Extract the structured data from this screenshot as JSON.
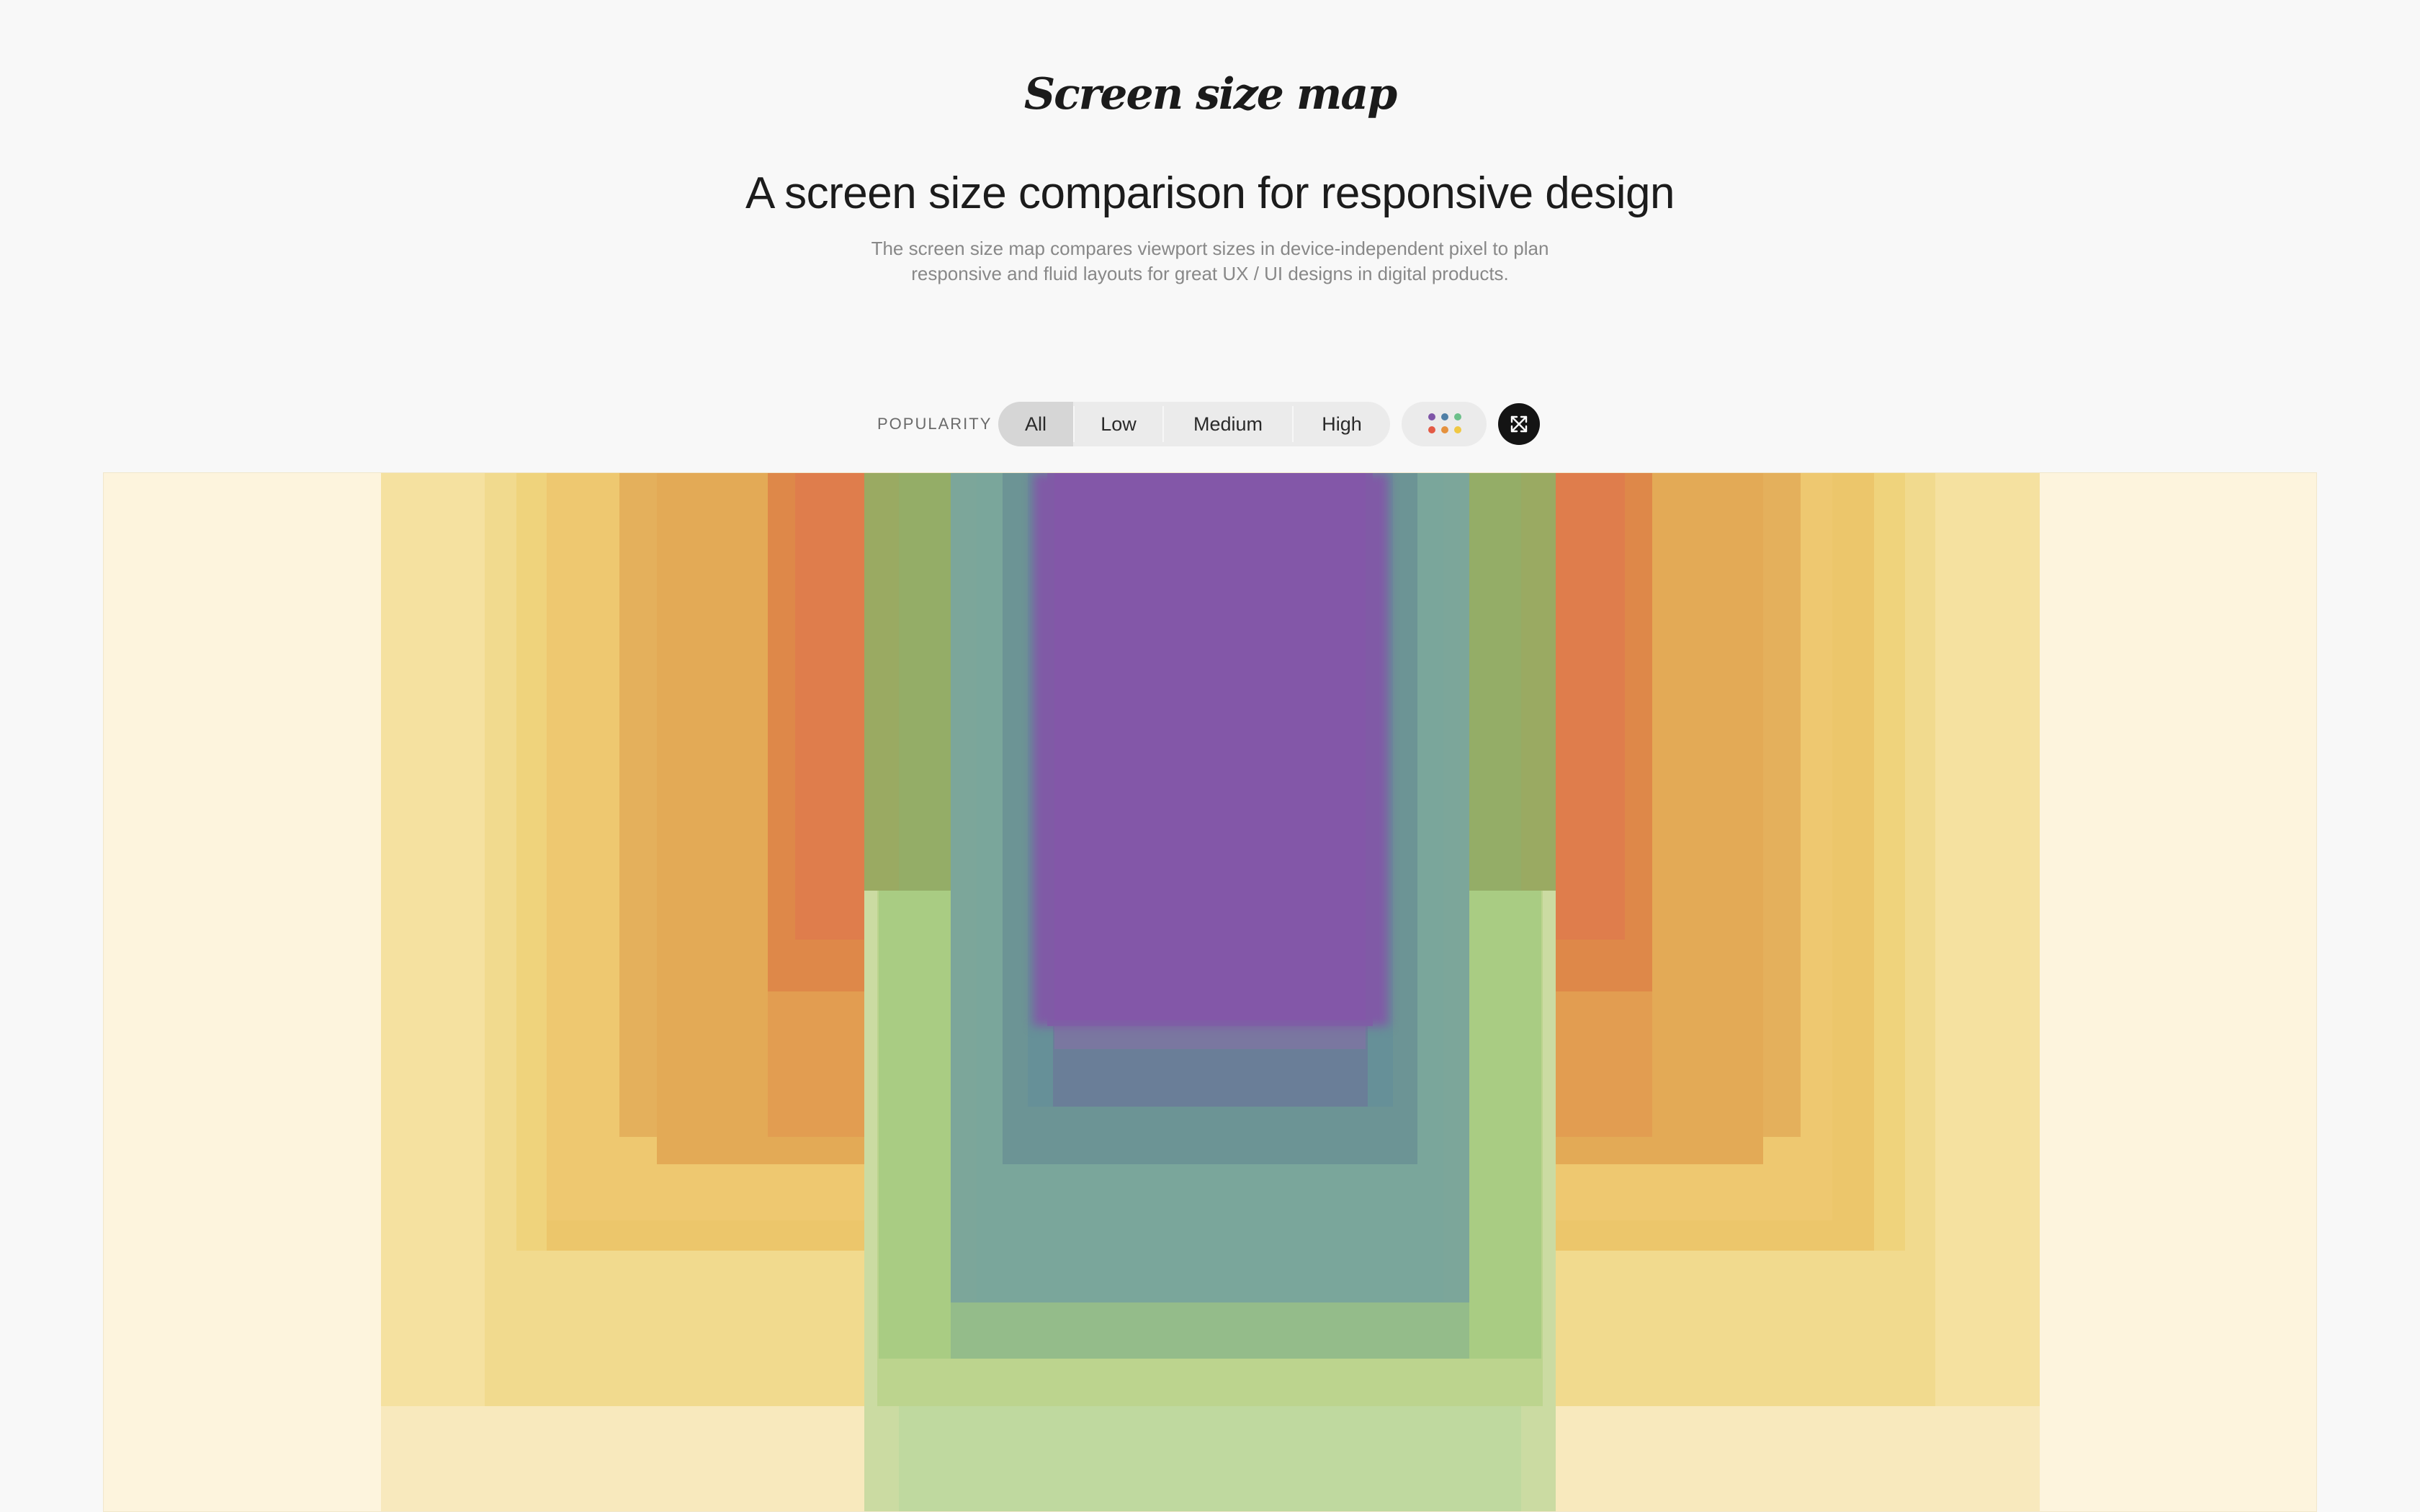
{
  "header": {
    "logo_text": "Screen size map",
    "headline": "A screen size comparison for responsive design",
    "description_line1": "The screen size map compares viewport sizes in device-independent pixel to plan",
    "description_line2": "responsive and fluid layouts for great UX / UI designs in digital products."
  },
  "controls": {
    "popularity_label": "POPULARITY",
    "filters": [
      "All",
      "Low",
      "Medium",
      "High"
    ],
    "selected_filter": "All",
    "color_toggle_icon": "color-dots-icon",
    "expand_icon": "expand-arrows-icon",
    "dot_colors": [
      "#7e55a7",
      "#4f7fa6",
      "#6cc08a",
      "#e35a45",
      "#e5913d",
      "#f0c843"
    ]
  },
  "map": {
    "colors": {
      "lightest": "#fdf4dd",
      "yellow": "#f2db8c",
      "orange": "#e2a453",
      "red_orange": "#df7e4f",
      "green": "#a6c784",
      "teal": "#6c9a98",
      "purple": "#7e55a7"
    }
  }
}
